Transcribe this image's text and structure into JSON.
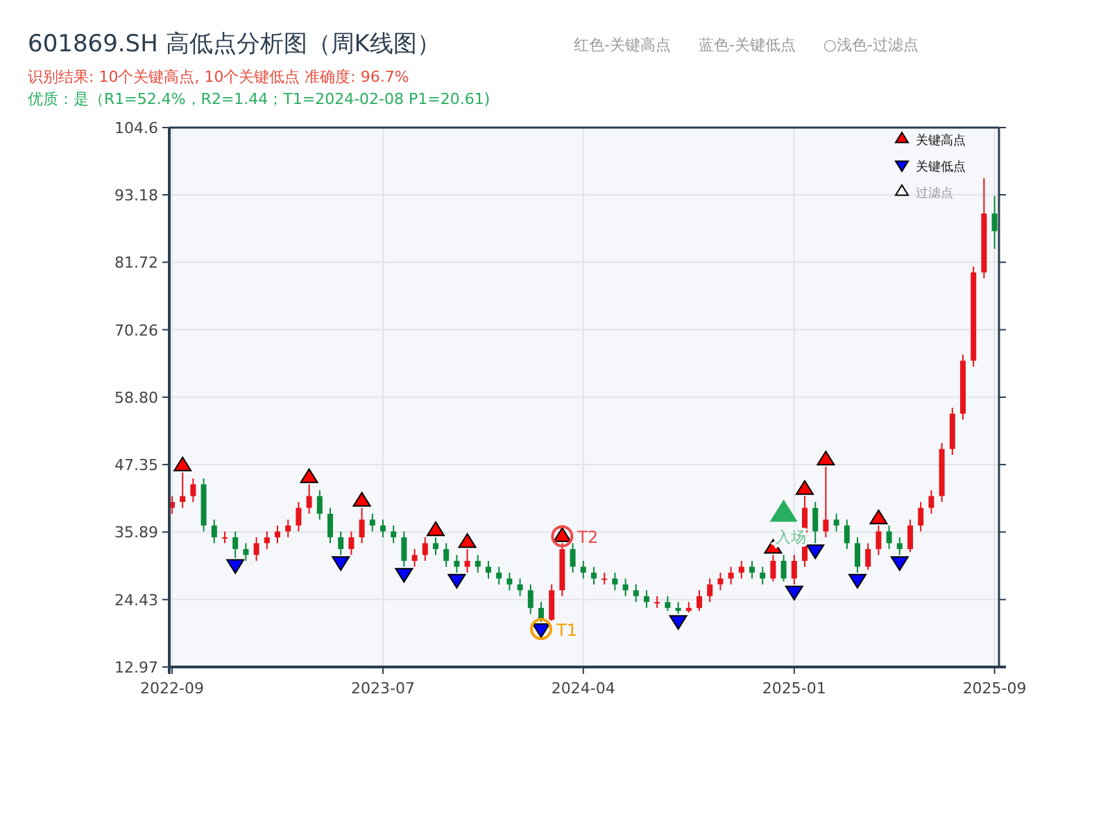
{
  "title": "601869.SH 高低点分析图（周K线图）",
  "header_legend": [
    "红色-关键高点",
    "蓝色-关键低点",
    "○浅色-过滤点"
  ],
  "result_line": "识别结果: 10个关键高点, 10个关键低点   准确度: 96.7%",
  "quality_line": "优质：是（R1=52.4%，R2=1.44；T1=2024-02-08 P1=20.61)",
  "chart": {
    "legend": [
      {
        "kind": "high",
        "label": "关键高点"
      },
      {
        "kind": "low",
        "label": "关键低点"
      },
      {
        "kind": "filtered",
        "label": "过滤点"
      }
    ],
    "pivots": [
      {
        "kind": "none"
      },
      {
        "kind": "high"
      },
      {
        "kind": "none"
      },
      {
        "kind": "none"
      },
      {
        "kind": "none"
      },
      {
        "kind": "none"
      },
      {
        "kind": "low"
      },
      {
        "kind": "none"
      },
      {
        "kind": "none"
      },
      {
        "kind": "none"
      },
      {
        "kind": "none"
      },
      {
        "kind": "none"
      },
      {
        "kind": "none"
      },
      {
        "kind": "high"
      },
      {
        "kind": "none"
      },
      {
        "kind": "none"
      },
      {
        "kind": "low"
      },
      {
        "kind": "none"
      },
      {
        "kind": "high"
      },
      {
        "kind": "none"
      },
      {
        "kind": "none"
      },
      {
        "kind": "none"
      },
      {
        "kind": "low"
      },
      {
        "kind": "none"
      },
      {
        "kind": "none"
      },
      {
        "kind": "high"
      },
      {
        "kind": "none"
      },
      {
        "kind": "low"
      },
      {
        "kind": "high"
      },
      {
        "kind": "none"
      },
      {
        "kind": "none"
      },
      {
        "kind": "none"
      },
      {
        "kind": "none"
      },
      {
        "kind": "none"
      },
      {
        "kind": "none"
      },
      {
        "kind": "low-ring"
      },
      {
        "kind": "none"
      },
      {
        "kind": "high-ring"
      },
      {
        "kind": "none"
      },
      {
        "kind": "none"
      },
      {
        "kind": "none"
      },
      {
        "kind": "none"
      },
      {
        "kind": "none"
      },
      {
        "kind": "none"
      },
      {
        "kind": "none"
      },
      {
        "kind": "none"
      },
      {
        "kind": "none"
      },
      {
        "kind": "none"
      },
      {
        "kind": "low"
      },
      {
        "kind": "none"
      },
      {
        "kind": "none"
      },
      {
        "kind": "none"
      },
      {
        "kind": "none"
      },
      {
        "kind": "none"
      },
      {
        "kind": "none"
      },
      {
        "kind": "none"
      },
      {
        "kind": "none"
      },
      {
        "kind": "high"
      },
      {
        "kind": "entry"
      },
      {
        "kind": "low"
      },
      {
        "kind": "high"
      },
      {
        "kind": "low"
      },
      {
        "kind": "high"
      },
      {
        "kind": "none"
      },
      {
        "kind": "none"
      },
      {
        "kind": "low"
      },
      {
        "kind": "none"
      },
      {
        "kind": "high"
      },
      {
        "kind": "none"
      },
      {
        "kind": "low"
      },
      {
        "kind": "none"
      },
      {
        "kind": "none"
      },
      {
        "kind": "none"
      },
      {
        "kind": "none"
      },
      {
        "kind": "none"
      },
      {
        "kind": "none"
      },
      {
        "kind": "none"
      },
      {
        "kind": "none"
      },
      {
        "kind": "none"
      }
    ],
    "chart_data": {
      "type": "candlestick",
      "ylim": [
        12.97,
        104.6
      ],
      "grid": true,
      "yticks": [
        {
          "value": 12.97,
          "label": "12.97"
        },
        {
          "value": 24.43,
          "label": "24.43"
        },
        {
          "value": 35.89,
          "label": "35.89"
        },
        {
          "value": 47.35,
          "label": "47.35"
        },
        {
          "value": 58.8,
          "label": "58.80"
        },
        {
          "value": 70.26,
          "label": "70.26"
        },
        {
          "value": 81.72,
          "label": "81.72"
        },
        {
          "value": 93.18,
          "label": "93.18"
        },
        {
          "value": 104.6,
          "label": "104.6"
        }
      ],
      "categories": [
        "2022-09",
        null,
        null,
        null,
        null,
        null,
        null,
        null,
        null,
        null,
        null,
        null,
        null,
        null,
        null,
        null,
        null,
        null,
        null,
        null,
        "2023-07",
        null,
        null,
        null,
        null,
        null,
        null,
        null,
        null,
        null,
        null,
        null,
        null,
        null,
        null,
        null,
        null,
        null,
        null,
        "2024-04",
        null,
        null,
        null,
        null,
        null,
        null,
        null,
        null,
        null,
        null,
        null,
        null,
        null,
        null,
        null,
        null,
        null,
        null,
        null,
        "2025-01",
        null,
        null,
        null,
        null,
        null,
        null,
        null,
        null,
        null,
        null,
        null,
        null,
        null,
        null,
        null,
        null,
        null,
        null,
        "2025-09"
      ],
      "ohlc": [
        [
          40,
          42,
          39,
          41
        ],
        [
          41,
          46,
          40,
          42
        ],
        [
          42,
          45,
          41,
          44
        ],
        [
          44,
          45,
          36,
          37
        ],
        [
          37,
          38,
          34,
          35
        ],
        [
          35,
          36,
          34,
          35
        ],
        [
          35,
          36,
          31.5,
          33
        ],
        [
          33,
          34,
          31,
          32
        ],
        [
          32,
          35,
          31,
          34
        ],
        [
          34,
          36,
          33,
          35
        ],
        [
          35,
          37,
          34,
          36
        ],
        [
          36,
          38,
          35,
          37
        ],
        [
          37,
          41,
          36,
          40
        ],
        [
          40,
          44,
          39,
          42
        ],
        [
          42,
          43,
          38,
          39
        ],
        [
          39,
          40,
          34,
          35
        ],
        [
          35,
          36,
          32,
          33
        ],
        [
          33,
          36,
          32,
          35
        ],
        [
          35,
          40,
          34,
          38
        ],
        [
          38,
          39,
          36,
          37
        ],
        [
          37,
          38,
          35,
          36
        ],
        [
          36,
          37,
          34,
          35
        ],
        [
          35,
          36,
          30,
          31
        ],
        [
          31,
          33,
          30,
          32
        ],
        [
          32,
          35,
          31,
          34
        ],
        [
          34,
          35,
          32,
          33
        ],
        [
          33,
          34,
          30,
          31
        ],
        [
          31,
          32,
          29,
          30
        ],
        [
          30,
          33,
          29,
          31
        ],
        [
          31,
          32,
          29,
          30
        ],
        [
          30,
          31,
          28,
          29
        ],
        [
          29,
          30,
          27,
          28
        ],
        [
          28,
          29,
          26,
          27
        ],
        [
          27,
          28,
          25,
          26
        ],
        [
          26,
          27,
          22,
          23
        ],
        [
          23,
          24,
          20.6,
          21
        ],
        [
          21,
          27,
          20.8,
          26
        ],
        [
          26,
          34,
          25,
          33
        ],
        [
          33,
          34,
          29,
          30
        ],
        [
          30,
          31,
          28,
          29
        ],
        [
          29,
          30,
          27,
          28
        ],
        [
          28,
          29,
          27,
          28
        ],
        [
          28,
          29,
          26,
          27
        ],
        [
          27,
          28,
          25,
          26
        ],
        [
          26,
          27,
          24,
          25
        ],
        [
          25,
          26,
          23,
          24
        ],
        [
          24,
          25,
          23,
          24
        ],
        [
          24,
          25,
          22.5,
          23
        ],
        [
          23,
          24,
          22,
          22.5
        ],
        [
          22.5,
          24,
          22.2,
          23
        ],
        [
          23,
          26,
          22.5,
          25
        ],
        [
          25,
          28,
          24,
          27
        ],
        [
          27,
          29,
          26,
          28
        ],
        [
          28,
          30,
          27,
          29
        ],
        [
          29,
          31,
          28,
          30
        ],
        [
          30,
          31,
          28,
          29
        ],
        [
          29,
          30,
          27,
          28
        ],
        [
          28,
          32,
          27.5,
          31
        ],
        [
          31,
          32,
          27.5,
          28
        ],
        [
          28,
          32,
          27,
          31
        ],
        [
          31,
          42,
          30,
          40
        ],
        [
          40,
          41,
          34,
          36
        ],
        [
          36,
          47,
          35,
          38
        ],
        [
          38,
          39,
          36,
          37
        ],
        [
          37,
          38,
          33,
          34
        ],
        [
          34,
          35,
          29,
          30
        ],
        [
          30,
          34,
          29.5,
          33
        ],
        [
          33,
          37,
          32,
          36
        ],
        [
          36,
          37,
          33,
          34
        ],
        [
          34,
          35,
          32,
          33
        ],
        [
          33,
          38,
          32.5,
          37
        ],
        [
          37,
          41,
          36,
          40
        ],
        [
          40,
          43,
          39,
          42
        ],
        [
          42,
          51,
          41,
          50
        ],
        [
          50,
          57,
          49,
          56
        ],
        [
          56,
          66,
          55,
          65
        ],
        [
          65,
          81,
          64,
          80
        ],
        [
          80,
          96,
          79,
          90
        ],
        [
          90,
          93,
          84,
          87
        ]
      ],
      "annotations": [
        {
          "text": "T1"
        },
        {
          "text": "T2"
        },
        {
          "text": "入场"
        }
      ]
    }
  }
}
